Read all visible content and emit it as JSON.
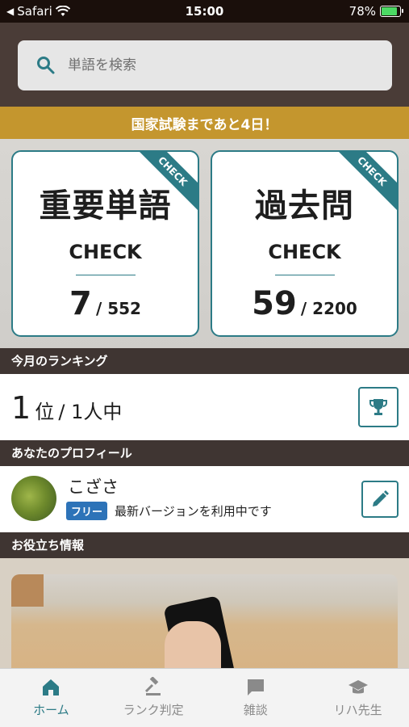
{
  "status_bar": {
    "back_app": "Safari",
    "time": "15:00",
    "battery": "78%",
    "battery_level": 0.78
  },
  "search": {
    "placeholder": "単語を検索"
  },
  "countdown": "国家試験まであと4日！",
  "cards": [
    {
      "title": "重要単語",
      "subtitle": "CHECK",
      "count": "7",
      "total": "/ 552",
      "ribbon": "CHECK"
    },
    {
      "title": "過去問",
      "subtitle": "CHECK",
      "count": "59",
      "total": "/ 2200",
      "ribbon": "CHECK"
    }
  ],
  "ranking": {
    "header": "今月のランキング",
    "rank": "1",
    "rank_unit": "位",
    "of_text": "/ 1人中"
  },
  "profile": {
    "header": "あなたのプロフィール",
    "name": "こざさ",
    "badge": "フリー",
    "status": "最新バージョンを利用中です"
  },
  "info": {
    "header": "お役立ち情報"
  },
  "tabs": [
    {
      "label": "ホーム",
      "icon": "home-icon",
      "active": true
    },
    {
      "label": "ランク判定",
      "icon": "gavel-icon",
      "active": false
    },
    {
      "label": "雑談",
      "icon": "chat-icon",
      "active": false
    },
    {
      "label": "リハ先生",
      "icon": "graduation-cap-icon",
      "active": false
    }
  ],
  "colors": {
    "accent": "#2c7b86",
    "gold": "#c4962e",
    "header_bg": "#4a3c37",
    "badge_blue": "#2d73b8"
  }
}
